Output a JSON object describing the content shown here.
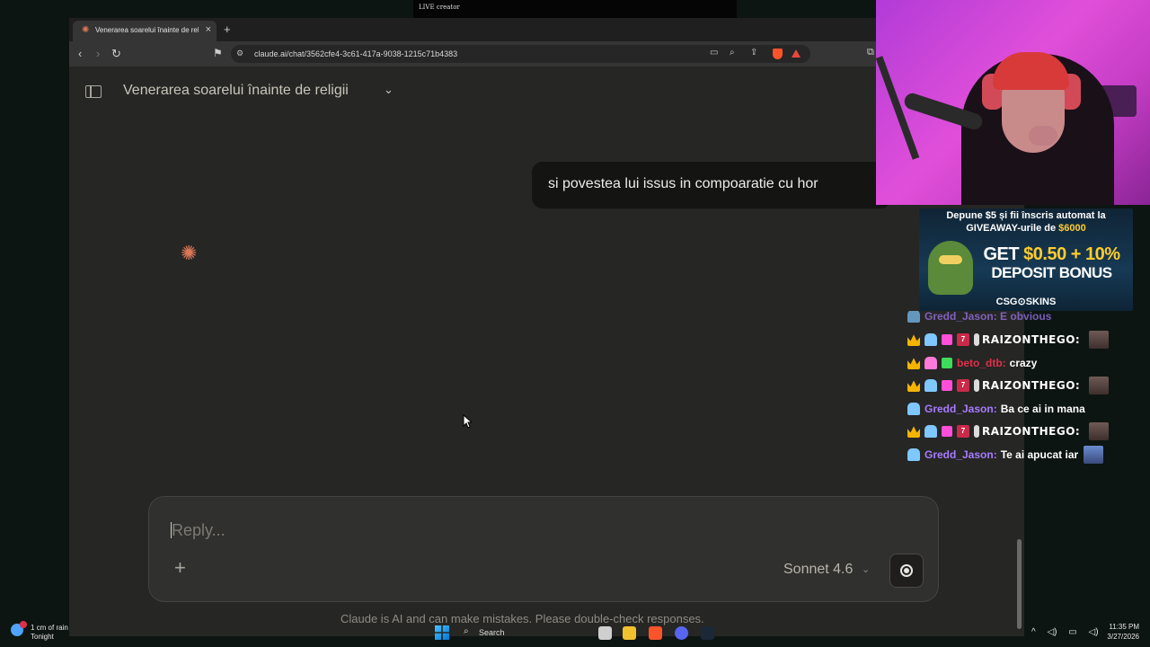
{
  "stream": {
    "live_label": "LIVE creator"
  },
  "browser": {
    "tab_title": "Venerarea soarelui înainte de religii",
    "tab_close": "×",
    "new_tab": "+",
    "url": "claude.ai/chat/3562cfe4-3c61-417a-9038-1215c71b4383"
  },
  "claude": {
    "chat_title": "Venerarea soarelui înainte de religii",
    "user_message": "si povestea lui issus in compoaratie cu hor",
    "composer_placeholder": "Reply...",
    "model_label": "Sonnet 4.6",
    "disclaimer": "Claude is AI and can make mistakes. Please double-check responses."
  },
  "ad": {
    "line1": "Depune $5 și fii înscris automat la",
    "line2_prefix": "GIVEAWAY-urile de",
    "line2_amount": "$6000",
    "big_prefix": "GET",
    "big_amount": "$0.50 + 10%",
    "big2": "DEPOSIT BONUS",
    "brand": "CSG⊙SKINS"
  },
  "chat": {
    "ghost": "Gredd_Jason: E obvious",
    "messages": [
      {
        "nick": "RAIZONTHEGO:",
        "text": "",
        "style": "raiz"
      },
      {
        "nick": "beto_dtb:",
        "text": "crazy",
        "style": "red"
      },
      {
        "nick": "RAIZONTHEGO:",
        "text": "",
        "style": "raiz"
      },
      {
        "nick": "Gredd_Jason:",
        "text": "Ba ce ai in mana",
        "style": "purple"
      },
      {
        "nick": "RAIZONTHEGO:",
        "text": "",
        "style": "raiz"
      },
      {
        "nick": "Gredd_Jason:",
        "text": "Te ai apucat iar",
        "style": "purple"
      }
    ]
  },
  "taskbar": {
    "weather_line1": "1 cm of rain",
    "weather_line2": "Tonight",
    "search_label": "Search",
    "time": "11:35 PM",
    "date": "3/27/2026"
  }
}
